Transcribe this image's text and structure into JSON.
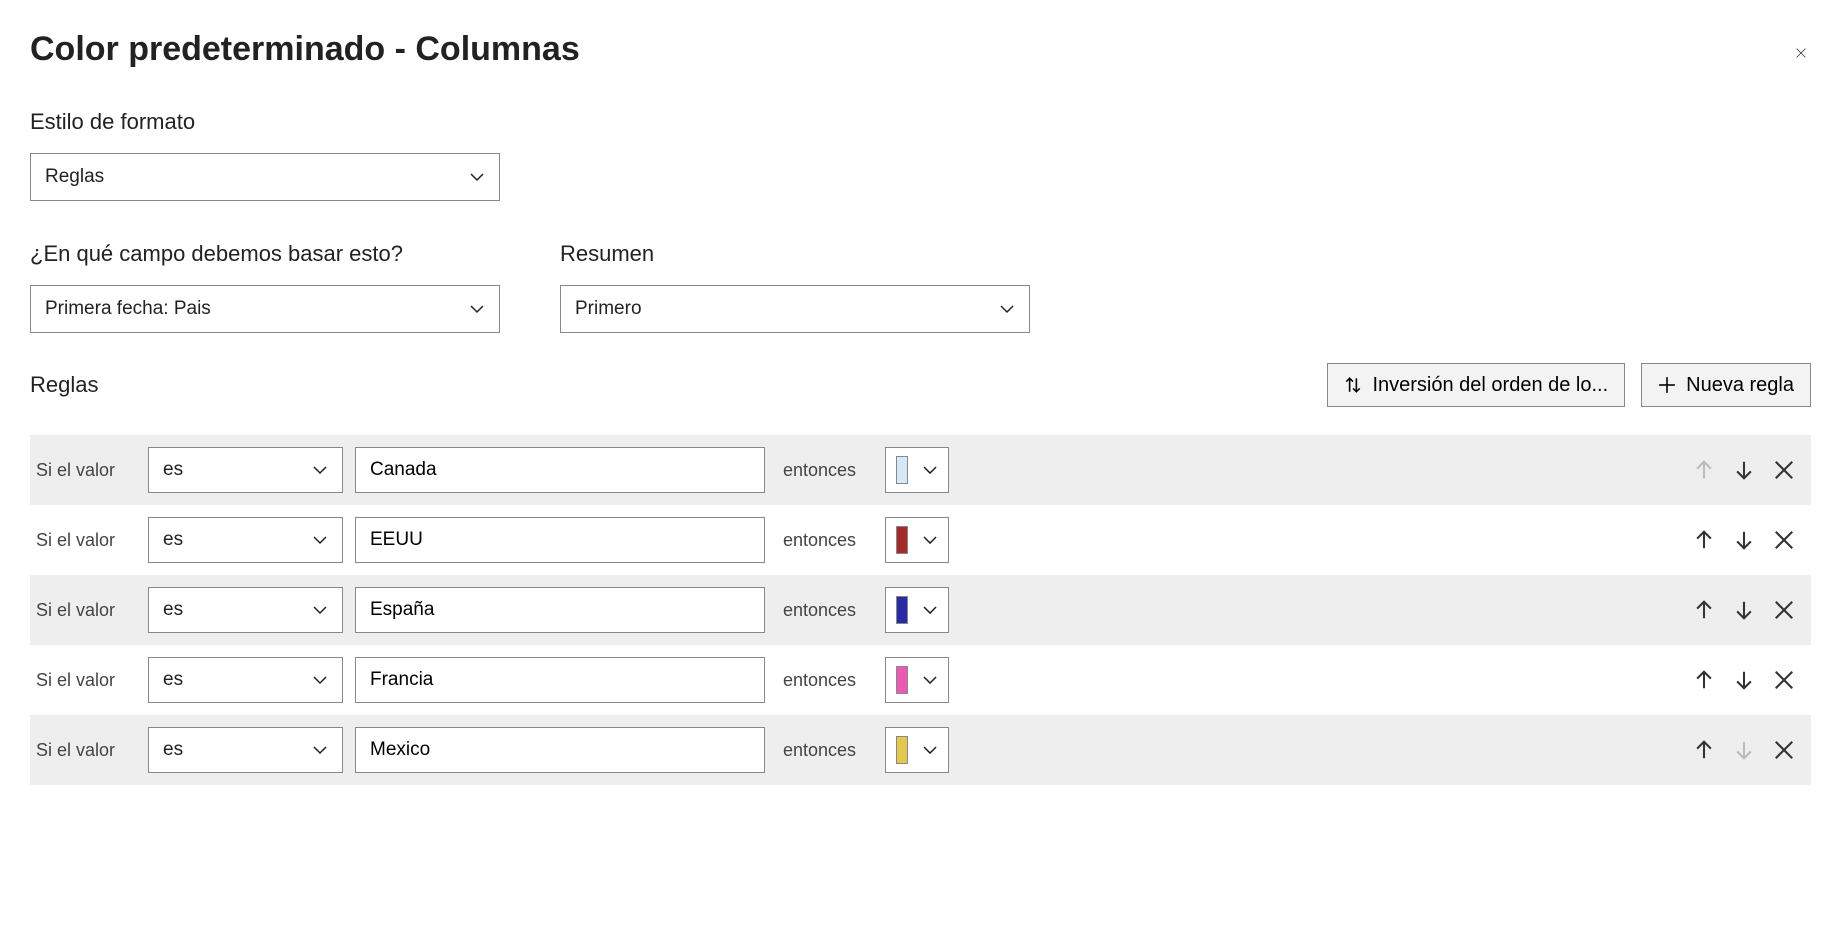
{
  "dialog": {
    "title": "Color predeterminado - Columnas"
  },
  "formatStyle": {
    "label": "Estilo de formato",
    "value": "Reglas"
  },
  "basedOn": {
    "label": "¿En qué campo debemos basar esto?",
    "value": "Primera fecha: Pais"
  },
  "summary": {
    "label": "Resumen",
    "value": "Primero"
  },
  "rulesSection": {
    "label": "Reglas",
    "reverseButton": "Inversión del orden de lo...",
    "newRuleButton": "Nueva regla"
  },
  "ruleText": {
    "if": "Si el valor",
    "op": "es",
    "then": "entonces"
  },
  "rules": [
    {
      "value": "Canada",
      "color": "#d6e8f5",
      "shaded": true,
      "upDisabled": true,
      "downDisabled": false
    },
    {
      "value": "EEUU",
      "color": "#a52a2a",
      "shaded": false,
      "upDisabled": false,
      "downDisabled": false
    },
    {
      "value": "España",
      "color": "#2a2aa5",
      "shaded": true,
      "upDisabled": false,
      "downDisabled": false
    },
    {
      "value": "Francia",
      "color": "#e85bb1",
      "shaded": false,
      "upDisabled": false,
      "downDisabled": false
    },
    {
      "value": "Mexico",
      "color": "#e3c84f",
      "shaded": true,
      "upDisabled": false,
      "downDisabled": true
    }
  ]
}
